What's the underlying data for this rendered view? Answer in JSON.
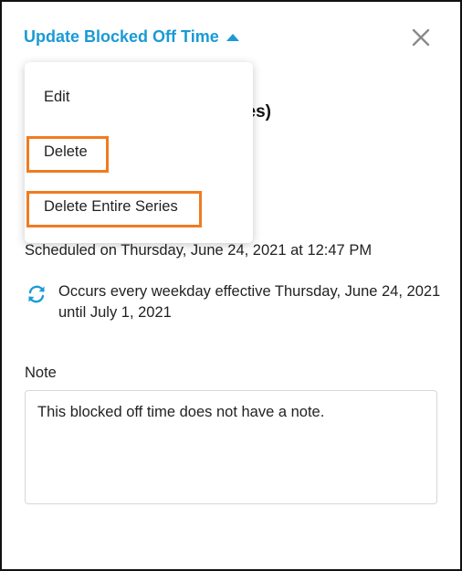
{
  "header": {
    "title": "Update Blocked Off Time",
    "caret_icon": "caret-up-icon",
    "close_icon": "close-icon",
    "accent_color": "#1a9ad6"
  },
  "menu": {
    "items": [
      {
        "label": "Edit",
        "highlighted": false
      },
      {
        "label": "Delete",
        "highlighted": true
      },
      {
        "label": "Delete Entire Series",
        "highlighted": true
      }
    ],
    "highlight_color": "#f07b22"
  },
  "details": {
    "partial_title": "nutes)",
    "scheduled_text": "Scheduled on Thursday, June 24, 2021 at 12:47 PM",
    "recurrence_icon": "sync-icon",
    "recurrence_text": "Occurs every weekday effective Thursday, June 24, 2021 until July 1, 2021"
  },
  "note": {
    "label": "Note",
    "text": "This blocked off time does not have a note."
  }
}
